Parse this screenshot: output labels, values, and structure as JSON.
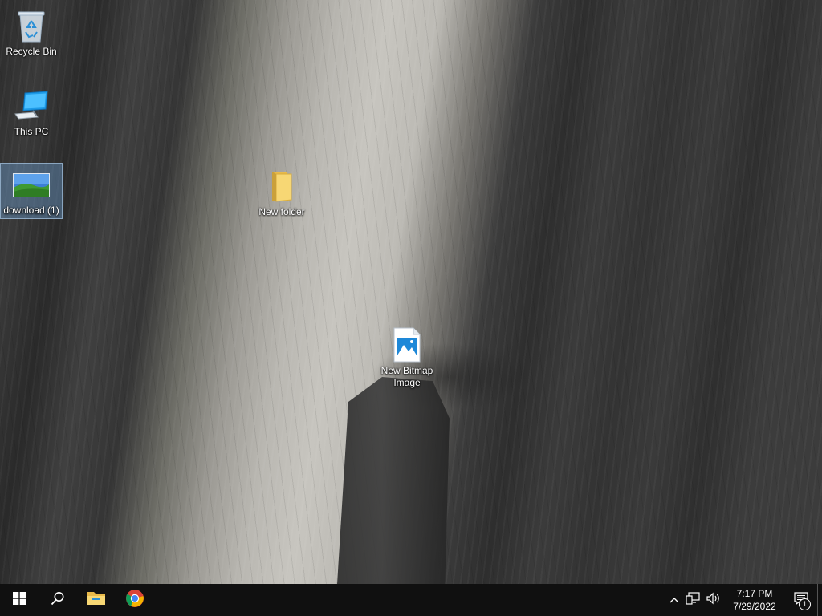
{
  "desktop": {
    "wallpaper": "granite-cliff-climbers",
    "icons": [
      {
        "label": "Recycle Bin",
        "icon": "recycle-bin-icon"
      },
      {
        "label": "This PC",
        "icon": "this-pc-icon"
      },
      {
        "label": "download (1)",
        "icon": "image-file-icon",
        "selected": true
      },
      {
        "label": "New folder",
        "icon": "folder-icon"
      },
      {
        "label": "New Bitmap Image",
        "icon": "bitmap-file-icon"
      }
    ]
  },
  "taskbar": {
    "background": "#101010",
    "start": {
      "icon": "windows-logo-icon"
    },
    "search": {
      "icon": "search-icon"
    },
    "pinned": [
      {
        "name": "File Explorer",
        "icon": "file-explorer-icon"
      },
      {
        "name": "Google Chrome",
        "icon": "chrome-icon"
      }
    ],
    "tray": {
      "chevron": "chevron-up-icon",
      "network": "network-icon",
      "volume": "volume-icon",
      "time": "7:17 PM",
      "date": "7/29/2022",
      "notifications": {
        "icon": "action-center-icon",
        "count": "1"
      }
    }
  }
}
